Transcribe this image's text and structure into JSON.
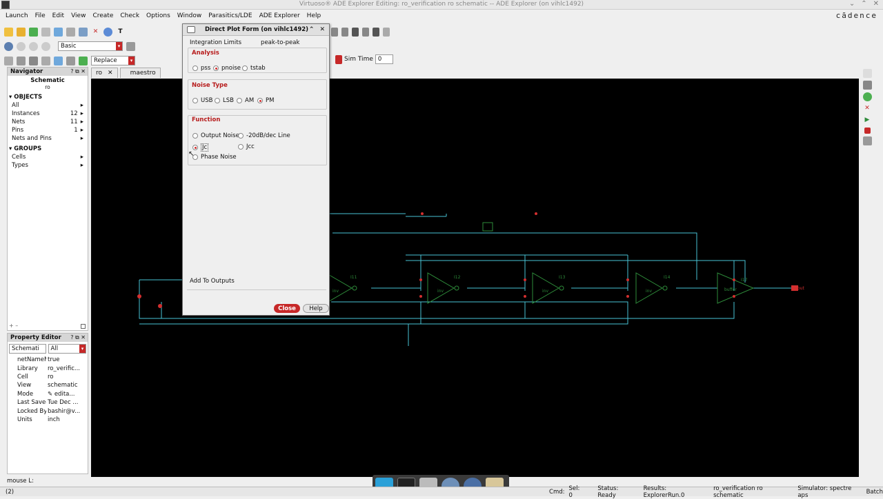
{
  "window": {
    "title": "Virtuoso® ADE Explorer Editing: ro_verification ro schematic -- ADE Explorer (on vihlc1492)",
    "brand": "cādence"
  },
  "menu": [
    "Launch",
    "File",
    "Edit",
    "View",
    "Create",
    "Check",
    "Options",
    "Window",
    "Parasitics/LDE",
    "ADE Explorer",
    "Help"
  ],
  "toolbar": {
    "mode_value": "Basic",
    "replace_value": "Replace",
    "sim_time_label": "Sim Time",
    "sim_time_value": "0"
  },
  "tabs": [
    {
      "label": "ro"
    },
    {
      "label": "maestro"
    }
  ],
  "navigator": {
    "title": "Navigator",
    "schematic_label": "Schematic",
    "cell_name": "ro",
    "objects_header": "OBJECTS",
    "rows": [
      {
        "label": "All",
        "count": ""
      },
      {
        "label": "Instances",
        "count": "12"
      },
      {
        "label": "Nets",
        "count": "11"
      },
      {
        "label": "Pins",
        "count": "1"
      },
      {
        "label": "Nets and Pins",
        "count": ""
      }
    ],
    "groups_header": "GROUPS",
    "group_rows": [
      {
        "label": "Cells"
      },
      {
        "label": "Types"
      }
    ]
  },
  "property_editor": {
    "title": "Property Editor",
    "filter1": "Schemati",
    "filter2": "All",
    "rows": [
      {
        "key": "netNameM...",
        "value": "true"
      },
      {
        "key": "Library",
        "value": "ro_verific..."
      },
      {
        "key": "Cell",
        "value": "ro"
      },
      {
        "key": "View",
        "value": "schematic"
      },
      {
        "key": "Mode",
        "value": "edita..."
      },
      {
        "key": "Last Saved",
        "value": "Tue Dec ..."
      },
      {
        "key": "Locked By",
        "value": "bashir@v..."
      },
      {
        "key": "Units",
        "value": "inch"
      }
    ]
  },
  "dialog": {
    "title": "Direct Plot Form (on vihlc1492)",
    "integration_label": "Integration Limits",
    "integration_option": "peak-to-peak",
    "analysis_header": "Analysis",
    "analysis_options": [
      "pss",
      "pnoise",
      "tstab"
    ],
    "analysis_selected": "pnoise",
    "noise_type_header": "Noise Type",
    "noise_type_options": [
      "USB",
      "LSB",
      "AM",
      "PM"
    ],
    "noise_type_selected": "PM",
    "function_header": "Function",
    "function_options": [
      "Output Noise",
      "-20dB/dec Line",
      "Jc",
      "Jcc",
      "Phase Noise"
    ],
    "function_selected": "Jc",
    "add_to_outputs": "Add To Outputs",
    "close_label": "Close",
    "help_label": "Help"
  },
  "schematic": {
    "instance_labels": [
      "I11",
      "I12",
      "I13",
      "I14",
      "I17"
    ],
    "cell_labels": [
      "inv",
      "inv",
      "inv",
      "inv",
      "buffer"
    ],
    "pin_label": "out"
  },
  "mouse_line": "mouse L:",
  "status": {
    "left": "(2)",
    "cmd": "Cmd:",
    "sel": "Sel: 0",
    "status": "Status: Ready",
    "results": "Results: ExplorerRun.0",
    "view": "ro_verification ro schematic",
    "simulator": "Simulator: spectre aps",
    "batch": "Batch"
  },
  "colors": {
    "canvas": "#000000",
    "wire": "#49c3d6",
    "accent": "#d32f2f",
    "gate": "#2e8b3a"
  }
}
